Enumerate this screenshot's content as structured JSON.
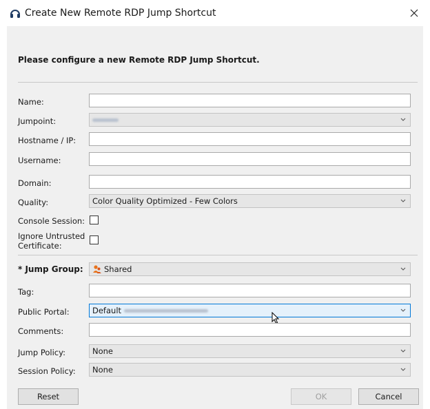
{
  "window": {
    "title": "Create New Remote RDP Jump Shortcut",
    "icon": "headset-icon",
    "close_icon": "close-icon"
  },
  "intro": "Please configure a new Remote RDP Jump Shortcut.",
  "form": {
    "name": {
      "label": "Name:",
      "value": ""
    },
    "jumpoint": {
      "label": "Jumpoint:",
      "value": ""
    },
    "hostname": {
      "label": "Hostname / IP:",
      "value": ""
    },
    "username": {
      "label": "Username:",
      "value": ""
    },
    "domain": {
      "label": "Domain:",
      "value": ""
    },
    "quality": {
      "label": "Quality:",
      "value": "Color Quality Optimized - Few Colors"
    },
    "console_session": {
      "label": "Console Session:",
      "checked": false
    },
    "ignore_cert": {
      "label_line1": "Ignore Untrusted",
      "label_line2": "Certificate:",
      "checked": false
    },
    "jump_group": {
      "label": "* Jump Group:",
      "value": "Shared",
      "icon": "group-icon"
    },
    "tag": {
      "label": "Tag:",
      "value": ""
    },
    "public_portal": {
      "label": "Public Portal:",
      "value": "Default"
    },
    "comments": {
      "label": "Comments:",
      "value": ""
    },
    "jump_policy": {
      "label": "Jump Policy:",
      "value": "None"
    },
    "session_policy": {
      "label": "Session Policy:",
      "value": "None"
    }
  },
  "buttons": {
    "reset": "Reset",
    "ok": "OK",
    "cancel": "Cancel"
  },
  "colors": {
    "focus_border": "#0078d7",
    "focus_bg": "#e5f1fb",
    "group_icon": "#e8731a"
  }
}
